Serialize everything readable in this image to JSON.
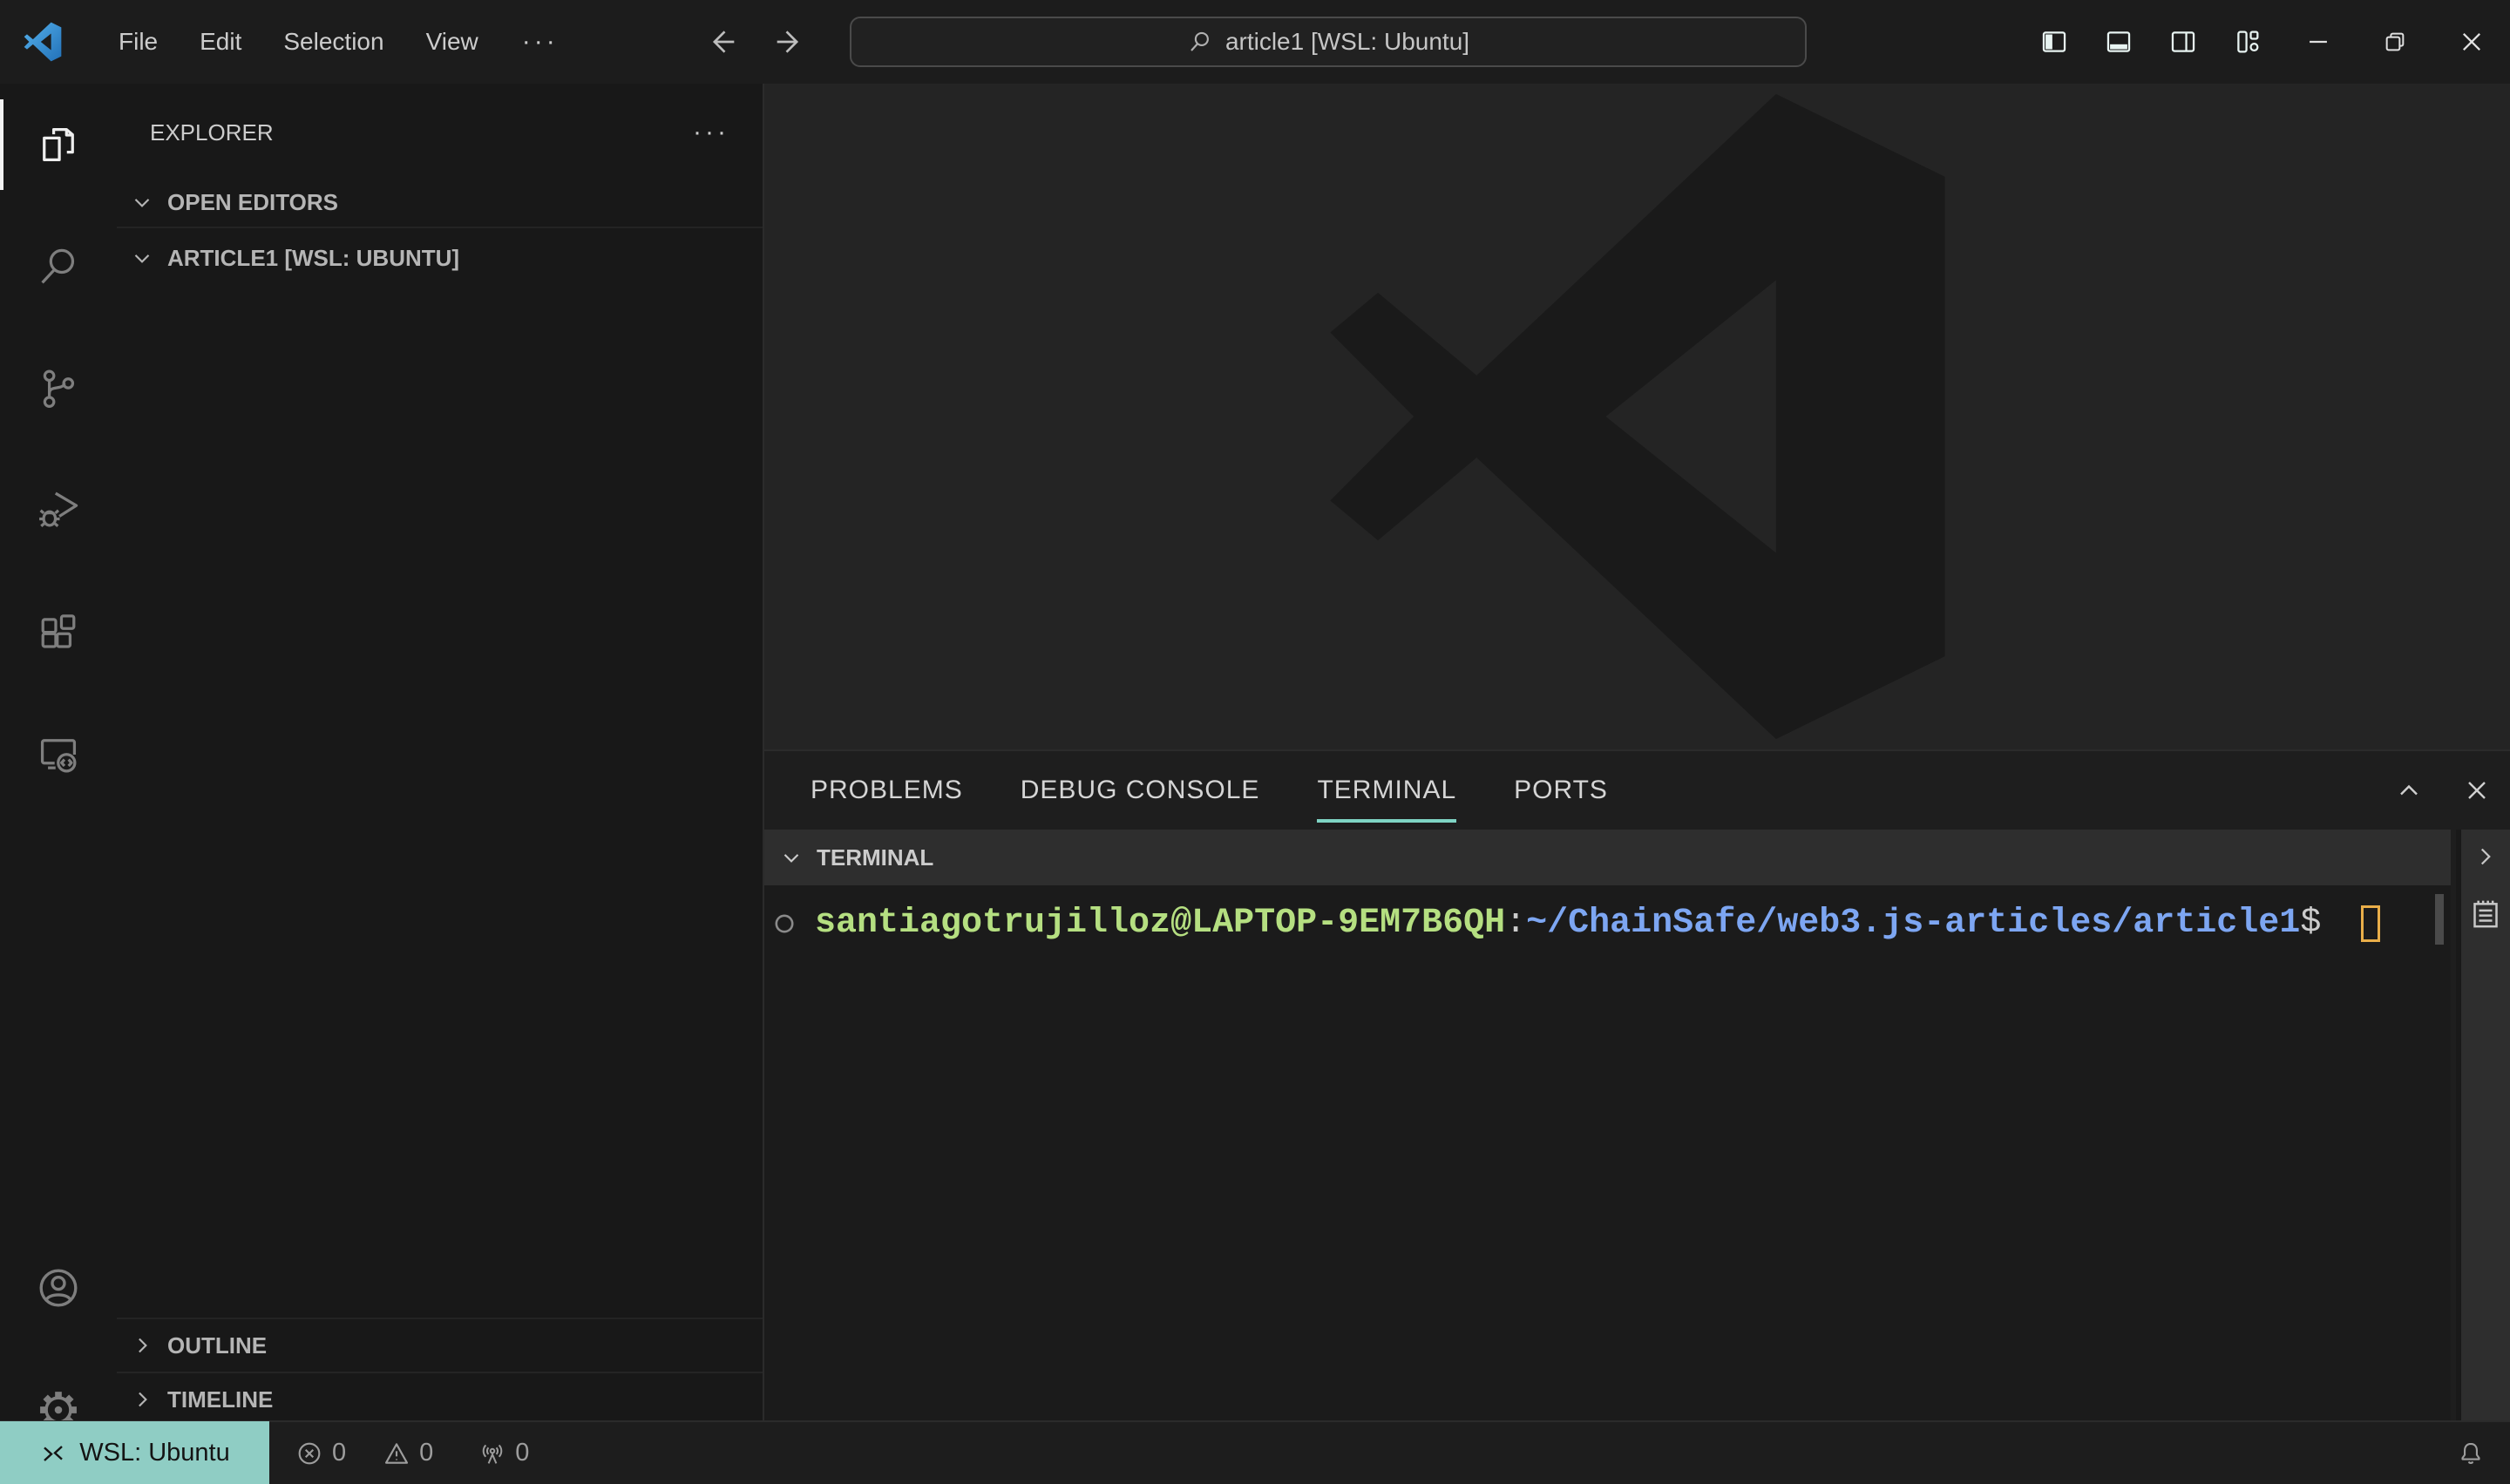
{
  "titlebar": {
    "menus": [
      "File",
      "Edit",
      "Selection",
      "View"
    ],
    "more_label": "···",
    "search_text": "article1 [WSL: Ubuntu]"
  },
  "activity_bar": {
    "items": [
      "explorer",
      "search",
      "source-control",
      "run-and-debug",
      "extensions",
      "remote-explorer"
    ],
    "bottom_items": [
      "accounts",
      "settings"
    ]
  },
  "sidebar": {
    "title": "EXPLORER",
    "more_label": "···",
    "open_editors": "OPEN EDITORS",
    "folder": "ARTICLE1 [WSL: UBUNTU]",
    "outline": "OUTLINE",
    "timeline": "TIMELINE"
  },
  "panel": {
    "tabs": [
      {
        "label": "PROBLEMS",
        "active": false
      },
      {
        "label": "DEBUG CONSOLE",
        "active": false
      },
      {
        "label": "TERMINAL",
        "active": true
      },
      {
        "label": "PORTS",
        "active": false
      }
    ],
    "terminal": {
      "drawer_title": "TERMINAL",
      "prompt": {
        "user_host": "santiagotrujilloz@LAPTOP-9EM7B6QH",
        "separator": ":",
        "path": "~/ChainSafe/web3.js-articles/article1",
        "symbol": "$ "
      }
    }
  },
  "status_bar": {
    "remote_label": "WSL: Ubuntu",
    "errors": "0",
    "warnings": "0",
    "ports": "0"
  },
  "icons": {
    "titlebar": [
      "vscode-logo",
      "back-arrow",
      "forward-arrow",
      "search",
      "layout-sidebar-left",
      "layout-panel",
      "layout-sidebar-right",
      "layout-customize",
      "minimize",
      "restore",
      "close"
    ],
    "panel": [
      "chevron-up",
      "close",
      "chevron-down",
      "chevron-right-expand",
      "terminal-tabs-list",
      "command-decoration-circle"
    ],
    "status": [
      "remote-indicator",
      "error-circle",
      "warning-triangle",
      "radio-tower",
      "bell"
    ]
  },
  "colors": {
    "remote_chip": "#8fcdc4",
    "tab_underline": "#7fd4c4",
    "prompt_user": "#b5df81",
    "prompt_path": "#7da6f2",
    "terminal_cursor": "#e9ae49",
    "activity_active": "#f2f2f2",
    "editor_bg": "#242424",
    "sidebar_bg": "#181818",
    "watermark": "#1a1a1a"
  }
}
